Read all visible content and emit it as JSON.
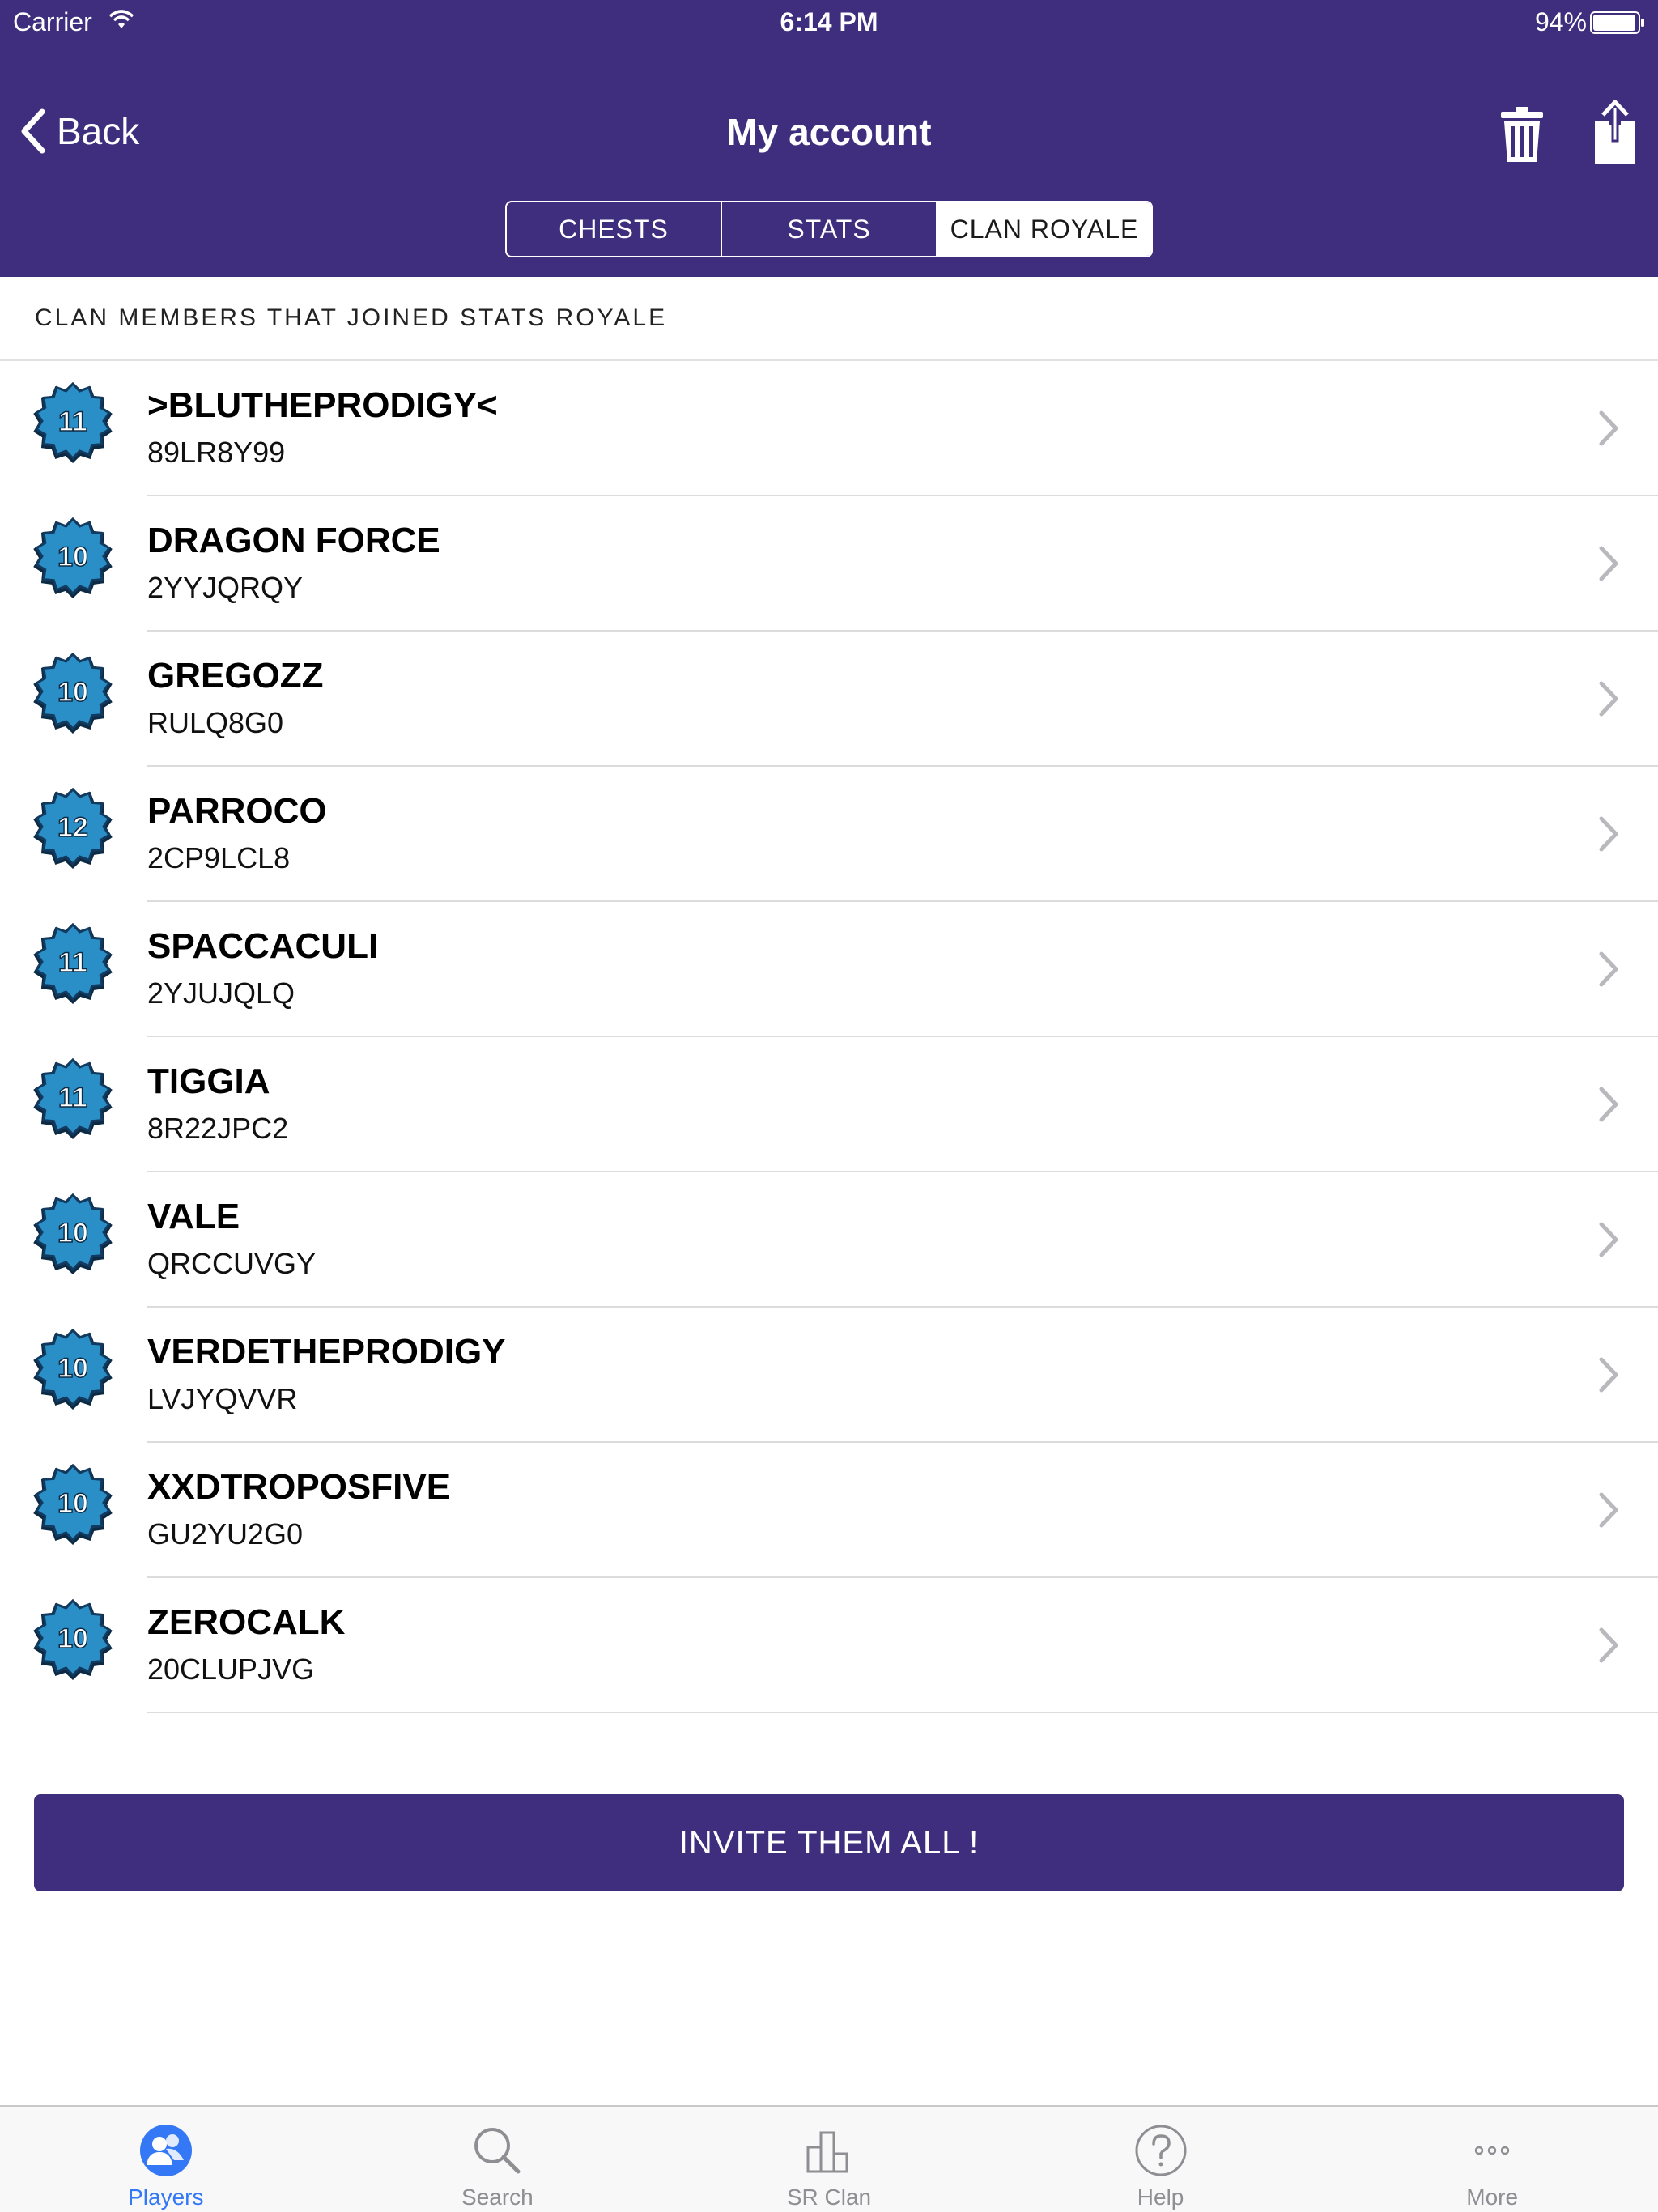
{
  "status_bar": {
    "carrier": "Carrier",
    "time": "6:14 PM",
    "battery": "94%"
  },
  "nav": {
    "back_label": "Back",
    "title": "My account"
  },
  "segments": [
    {
      "label": "CHESTS",
      "active": false
    },
    {
      "label": "STATS",
      "active": false
    },
    {
      "label": "CLAN ROYALE",
      "active": true
    }
  ],
  "section_title": "CLAN MEMBERS THAT JOINED STATS ROYALE",
  "members": [
    {
      "level": "11",
      "name": ">BLUTHEPRODIGY<",
      "tag": "89LR8Y99"
    },
    {
      "level": "10",
      "name": "DRAGON FORCE",
      "tag": "2YYJQRQY"
    },
    {
      "level": "10",
      "name": "GREGOZZ",
      "tag": "RULQ8G0"
    },
    {
      "level": "12",
      "name": "PARROCO",
      "tag": "2CP9LCL8"
    },
    {
      "level": "11",
      "name": "SPACCACULI",
      "tag": "2YJUJQLQ"
    },
    {
      "level": "11",
      "name": "TIGGIA",
      "tag": "8R22JPC2"
    },
    {
      "level": "10",
      "name": "VALE",
      "tag": "QRCCUVGY"
    },
    {
      "level": "10",
      "name": "VERDETHEPRODIGY",
      "tag": "LVJYQVVR"
    },
    {
      "level": "10",
      "name": "XXDTROPOSFIVE",
      "tag": "GU2YU2G0"
    },
    {
      "level": "10",
      "name": "ZEROCALK",
      "tag": "20CLUPJVG"
    }
  ],
  "invite_label": "INVITE THEM ALL !",
  "tabs": [
    {
      "label": "Players",
      "icon": "players-icon",
      "active": true
    },
    {
      "label": "Search",
      "icon": "search-icon",
      "active": false
    },
    {
      "label": "SR Clan",
      "icon": "sr-clan-icon",
      "active": false
    },
    {
      "label": "Help",
      "icon": "help-icon",
      "active": false
    },
    {
      "label": "More",
      "icon": "more-icon",
      "active": false
    }
  ],
  "colors": {
    "brand": "#3f2e7d",
    "tab_active": "#3478f6",
    "badge": "#2b8fc7"
  }
}
